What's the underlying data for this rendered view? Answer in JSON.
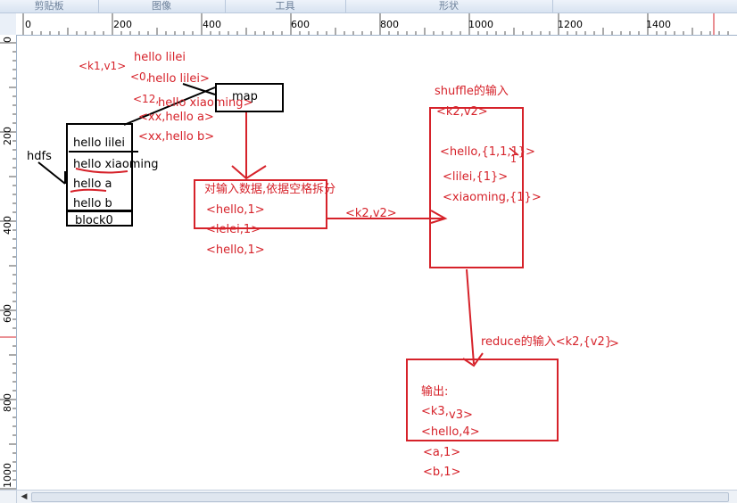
{
  "ribbon": {
    "groups": [
      "剪贴板",
      "图像",
      "工具",
      "形状"
    ]
  },
  "ruler": {
    "h_ticks": [
      "0",
      "200",
      "400",
      "600",
      "800",
      "1000",
      "1200",
      "1400"
    ],
    "v_ticks": [
      "0",
      "200",
      "400",
      "600",
      "800",
      "1000"
    ]
  },
  "diagram": {
    "hdfs_label": "hdfs",
    "block": {
      "lines": [
        "hello  lilei",
        "hello xiaoming",
        "hello a",
        "hello b"
      ],
      "footer": "block0"
    },
    "input": {
      "k1v1": "<k1,v1>",
      "line1": "hello lilei",
      "rec0_key": "<0,",
      "rec0_val": "hello lilei>",
      "rec12_key": "<12,",
      "rec12_val": "hello xiaoming>",
      "recxx_a": "<xx,hello a>",
      "recxx_b": "<xx,hello b>"
    },
    "map_label": "map",
    "split": {
      "title": "对输入数据,依据空格拆分",
      "items": [
        "<hello,1>",
        "<lelei,1>",
        "<hello,1>"
      ]
    },
    "k2v2_edge": "<k2,v2>",
    "shuffle": {
      "title": "shuffle的输入",
      "k2v2": "<k2,v2>",
      "hello": "<hello,{1,1,1}>",
      "extra_one": "1",
      "lilei": "<lilei,{1}>",
      "xiaoming": "<xiaoming,{1}>"
    },
    "reduce_label": "reduce的输入<k2,{v2}",
    "reduce_gt": ">",
    "output": {
      "title": "输出:",
      "k3": "<k3,",
      "v3": "v3>",
      "hello4": "<hello,4>",
      "a1": "<a,1>",
      "b1": "<b,1>"
    }
  }
}
